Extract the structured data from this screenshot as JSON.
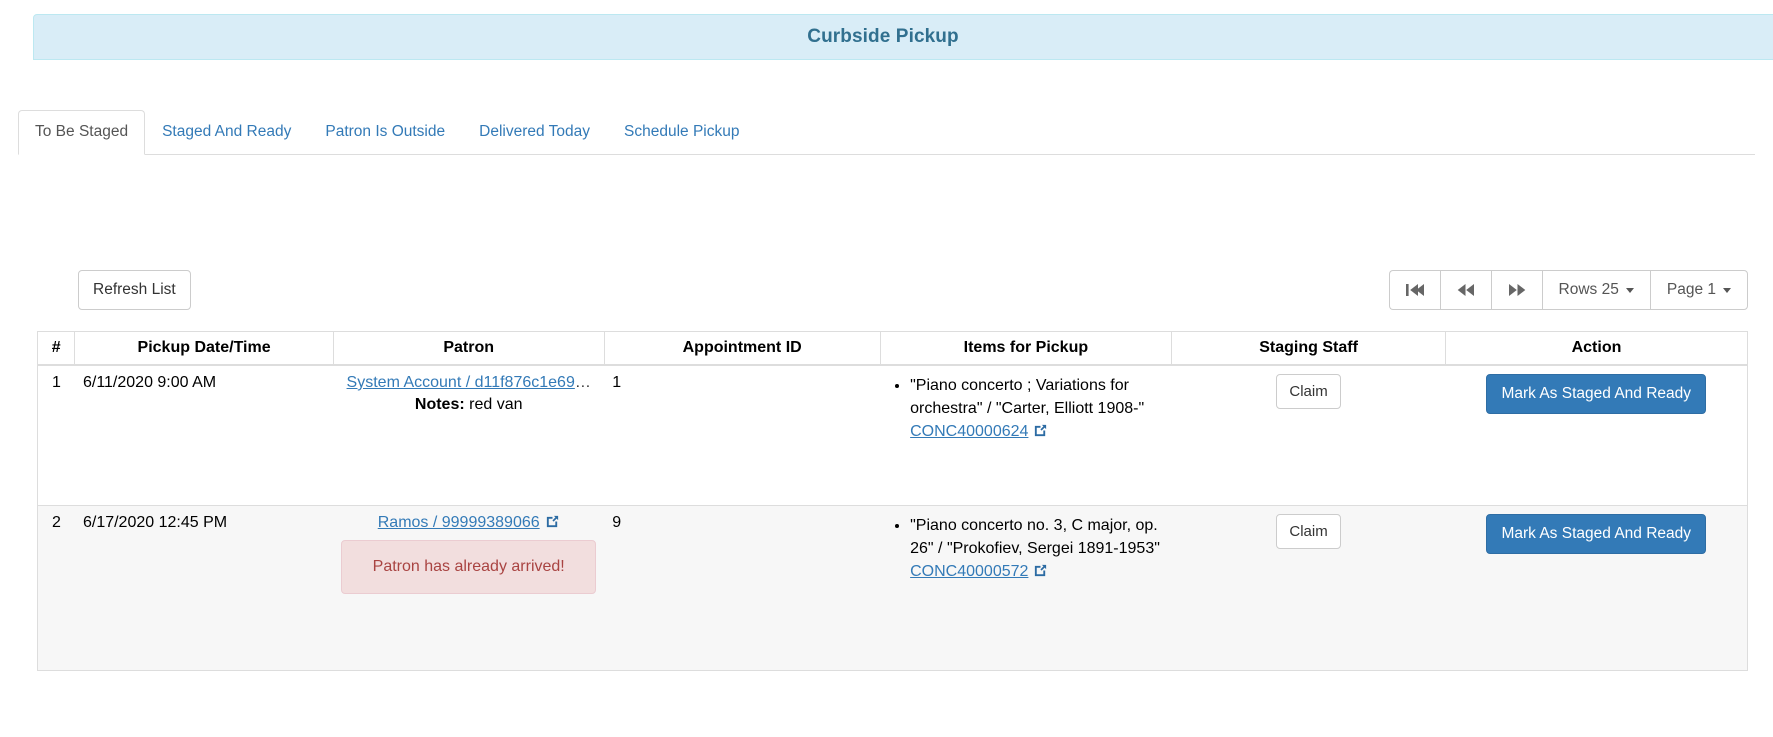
{
  "panel": {
    "title": "Curbside Pickup",
    "accent_bg": "#d9edf7",
    "accent_border": "#bce8f1",
    "title_color": "#31708f"
  },
  "tabs": [
    {
      "label": "To Be Staged",
      "active": true
    },
    {
      "label": "Staged And Ready",
      "active": false
    },
    {
      "label": "Patron Is Outside",
      "active": false
    },
    {
      "label": "Delivered Today",
      "active": false
    },
    {
      "label": "Schedule Pickup",
      "active": false
    }
  ],
  "toolbar": {
    "refresh_label": "Refresh List",
    "first_page_icon": "first-page-icon",
    "prev_page_icon": "previous-page-icon",
    "next_page_icon": "next-page-icon",
    "rows_label": "Rows 25",
    "page_label": "Page 1"
  },
  "table": {
    "headers": [
      "#",
      "Pickup Date/Time",
      "Patron",
      "Appointment ID",
      "Items for Pickup",
      "Staging Staff",
      "Action"
    ],
    "rows": [
      {
        "num": "1",
        "pickup_datetime": "6/11/2020 9:00 AM",
        "patron_link": "System Account / d11f876c1e69",
        "patron_truncated": "…",
        "patron_has_ext_icon": false,
        "notes_label": "Notes:",
        "notes_value": "red van",
        "alert": "",
        "appointment_id": "1",
        "item_title": "\"Piano concerto ; Variations for orchestra\" / \"Carter, Elliott 1908-\"",
        "item_barcode": "CONC40000624",
        "staff_button": "Claim",
        "action_button": "Mark As Staged And Ready",
        "striped": false
      },
      {
        "num": "2",
        "pickup_datetime": "6/17/2020 12:45 PM",
        "patron_link": "Ramos / 99999389066",
        "patron_truncated": "",
        "patron_has_ext_icon": true,
        "notes_label": "",
        "notes_value": "",
        "alert": "Patron has already arrived!",
        "appointment_id": "9",
        "item_title": "\"Piano concerto no. 3, C major, op. 26\" / \"Prokofiev, Sergei 1891-1953\"",
        "item_barcode": "CONC40000572",
        "staff_button": "Claim",
        "action_button": "Mark As Staged And Ready",
        "striped": true
      }
    ]
  },
  "colors": {
    "link": "#337ab7",
    "primary_button": "#337ab7",
    "alert_bg": "#f2dede",
    "alert_border": "#ebccd1",
    "alert_text": "#a94442"
  }
}
